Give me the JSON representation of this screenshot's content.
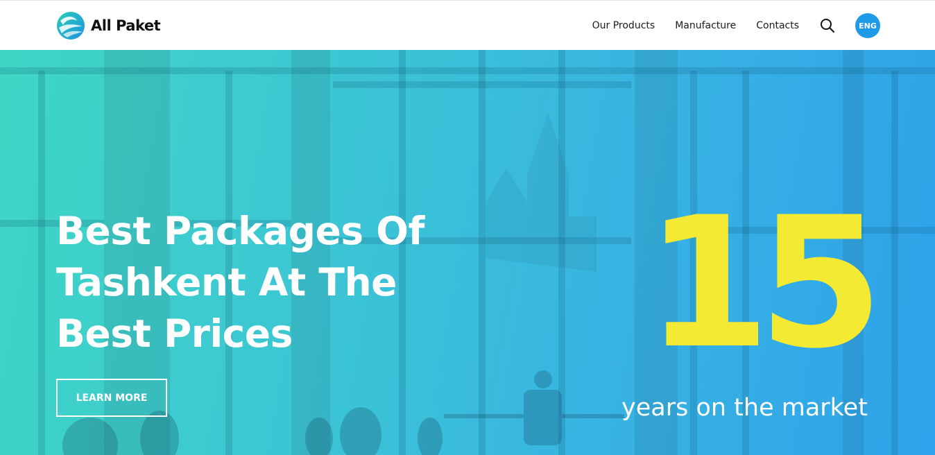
{
  "brand": {
    "name": "All Paket",
    "logo_icon": "swirl-logo-icon"
  },
  "nav": {
    "items": [
      {
        "label": "Our Products"
      },
      {
        "label": "Manufacture"
      },
      {
        "label": "Contacts"
      }
    ],
    "search_icon": "search-icon",
    "language": "ENG"
  },
  "hero": {
    "title": "Best Packages Of Tashkent At The Best Prices",
    "cta_label": "LEARN MORE",
    "years_number": "15",
    "years_caption": "years on the market"
  },
  "colors": {
    "accent_blue": "#1e9be8",
    "highlight_yellow": "#f5ea33",
    "hero_gradient_start": "#3fd6c4",
    "hero_gradient_end": "#2ea2ea"
  }
}
